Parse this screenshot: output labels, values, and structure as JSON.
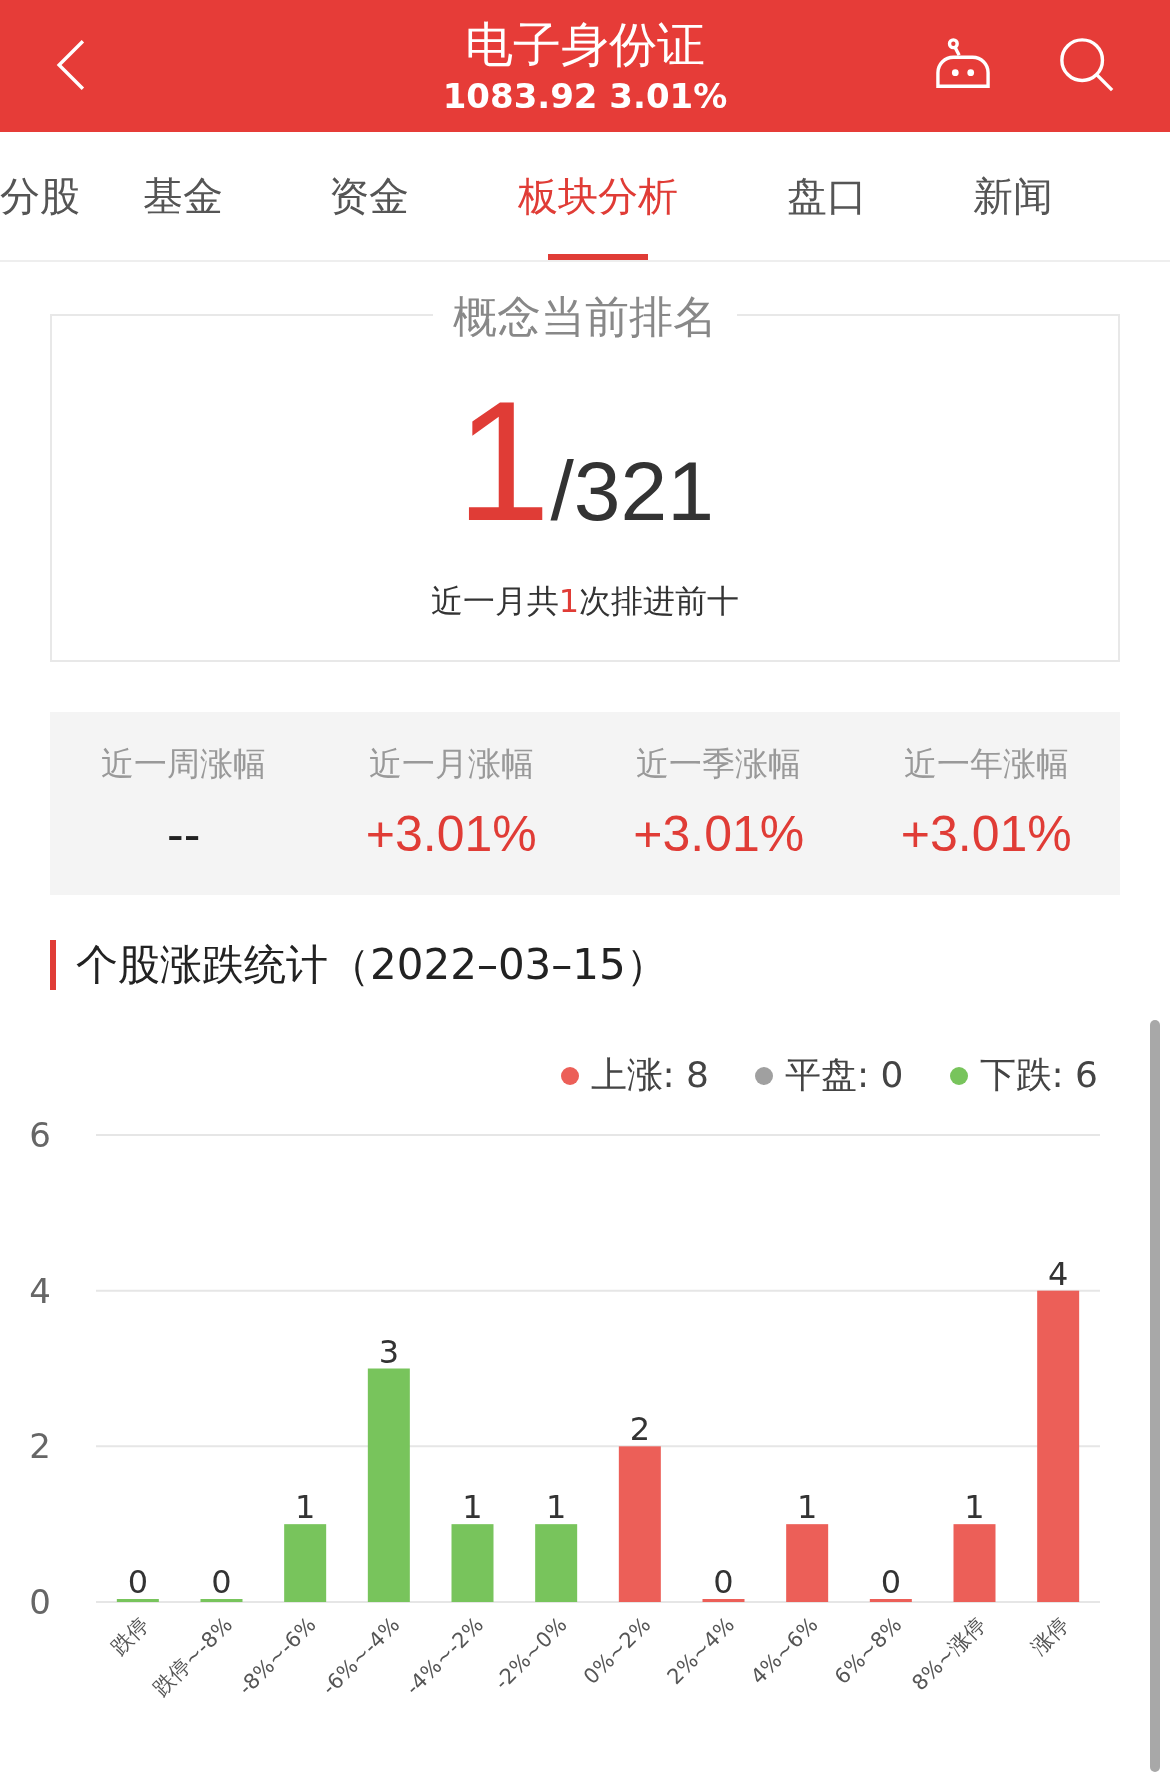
{
  "header": {
    "title": "电子身份证",
    "subtitle": "1083.92 3.01%"
  },
  "tabs": [
    {
      "label": "分股",
      "selected": false
    },
    {
      "label": "基金",
      "selected": false
    },
    {
      "label": "资金",
      "selected": false
    },
    {
      "label": "板块分析",
      "selected": true
    },
    {
      "label": "盘口",
      "selected": false
    },
    {
      "label": "新闻",
      "selected": false
    }
  ],
  "ranking": {
    "title": "概念当前排名",
    "rank": "1",
    "total": "/321",
    "note_prefix": "近一月共",
    "note_count": "1",
    "note_suffix": "次排进前十"
  },
  "stats": [
    {
      "label": "近一周涨幅",
      "value": "--",
      "kind": "empty"
    },
    {
      "label": "近一月涨幅",
      "value": "+3.01%",
      "kind": "rise"
    },
    {
      "label": "近一季涨幅",
      "value": "+3.01%",
      "kind": "rise"
    },
    {
      "label": "近一年涨幅",
      "value": "+3.01%",
      "kind": "rise"
    }
  ],
  "section_title": "个股涨跌统计（2022–03–15）",
  "legend": [
    {
      "label": "上涨: 8",
      "color": "#ec5f58"
    },
    {
      "label": "平盘: 0",
      "color": "#a0a0a0"
    },
    {
      "label": "下跌: 6",
      "color": "#78c45c"
    }
  ],
  "chart_data": {
    "type": "bar",
    "categories": [
      "跌停",
      "跌停~-8%",
      "-8%~-6%",
      "-6%~-4%",
      "-4%~-2%",
      "-2%~0%",
      "0%~2%",
      "2%~4%",
      "4%~6%",
      "6%~8%",
      "8%~涨停",
      "涨停"
    ],
    "series": [
      {
        "color": "#78c45c",
        "values": [
          0,
          0,
          1,
          3,
          1,
          1,
          null,
          null,
          null,
          null,
          null,
          null
        ]
      },
      {
        "color": "#ec5f58",
        "values": [
          null,
          null,
          null,
          null,
          null,
          null,
          2,
          0,
          1,
          0,
          1,
          4
        ]
      }
    ],
    "ylim": [
      0,
      6
    ],
    "yticks": [
      0,
      2,
      4,
      6
    ],
    "data_labels": true
  }
}
